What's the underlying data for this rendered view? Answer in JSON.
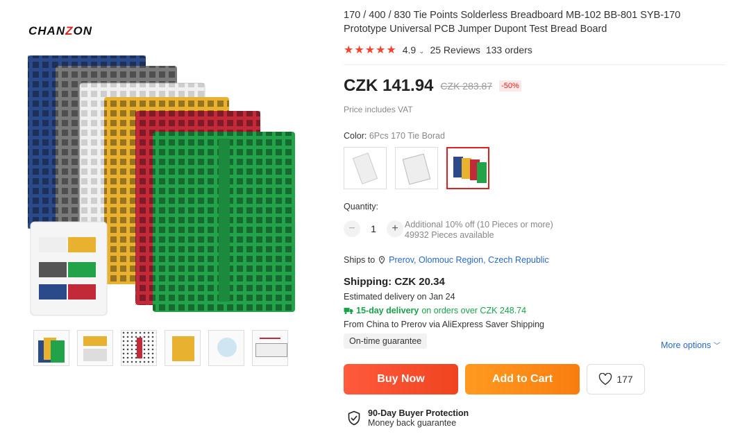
{
  "brand": "CHANZON",
  "product": {
    "title": "170 / 400 / 830 Tie Points Solderless Breadboard MB-102 BB-801 SYB-170 Prototype Universal PCB Jumper Dupont Test Bread Board",
    "rating_stars": "★★★★★",
    "rating": "4.9",
    "reviews": "25 Reviews",
    "orders": "133 orders"
  },
  "price": {
    "current": "CZK 141.94",
    "original": "CZK 283.87",
    "discount": "-50%",
    "vat_note": "Price includes VAT"
  },
  "color": {
    "label": "Color:",
    "selected": "6Pcs 170 Tie Borad"
  },
  "quantity": {
    "label": "Quantity:",
    "minus": "−",
    "value": "1",
    "plus": "+",
    "offer": "Additional 10% off (10 Pieces or more)",
    "available": "49932 Pieces available"
  },
  "shipping": {
    "ships_to_label": "Ships to",
    "ships_to_value": "Prerov, Olomouc Region, Czech Republic",
    "cost": "Shipping: CZK 20.34",
    "estimated_label": "Estimated delivery on",
    "estimated_date": "Jan 24",
    "fast_bold": "15-day delivery",
    "fast_rest": "on orders over CZK 248.74",
    "route": "From China to Prerov via AliExpress Saver Shipping",
    "guarantee": "On-time guarantee",
    "more_options": "More options"
  },
  "actions": {
    "buy_now": "Buy Now",
    "add_to_cart": "Add to Cart",
    "wishlist_count": "177"
  },
  "protection": {
    "title": "90-Day Buyer Protection",
    "subtitle": "Money back guarantee"
  },
  "colors": {
    "star": "#f5422f",
    "buy": "#f0441f",
    "cart": "#f97d10",
    "link": "#2868c9",
    "green": "#17a34a"
  }
}
